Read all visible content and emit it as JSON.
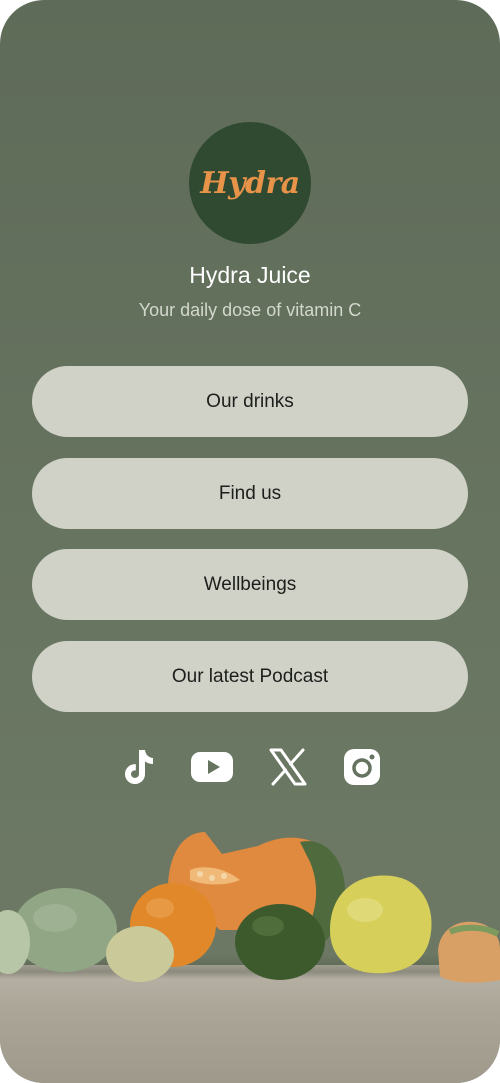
{
  "profile": {
    "logo_text": "Hydra",
    "name": "Hydra Juice",
    "tagline": "Your daily dose of vitamin C"
  },
  "links": [
    {
      "label": "Our drinks"
    },
    {
      "label": "Find us"
    },
    {
      "label": "Wellbeings"
    },
    {
      "label": "Our latest Podcast"
    }
  ],
  "socials": [
    {
      "icon": "tiktok-icon"
    },
    {
      "icon": "youtube-icon"
    },
    {
      "icon": "x-icon"
    },
    {
      "icon": "instagram-icon"
    }
  ],
  "colors": {
    "background": "#66735f",
    "button": "#d0d2c8",
    "logo_circle": "#2f4a30",
    "logo_text": "#e8934a"
  }
}
